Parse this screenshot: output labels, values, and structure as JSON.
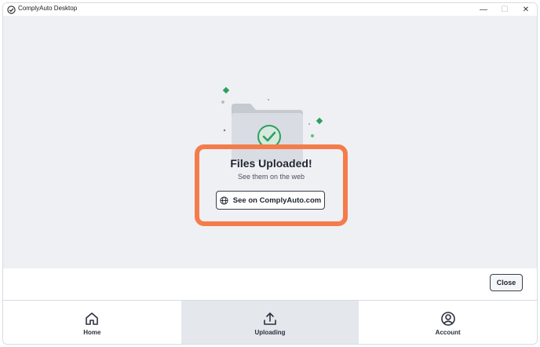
{
  "window": {
    "title": "ComplyAuto Desktop",
    "controls": {
      "minimize": "—",
      "maximize": "☐",
      "close": "✕"
    }
  },
  "status": {
    "title": "Files Uploaded!",
    "subtitle": "See them on the web",
    "web_button_label": "See on ComplyAuto.com",
    "web_button_icon": "globe-icon",
    "illustration_icon": "folder-check-icon",
    "highlight_color": "#f47c4b"
  },
  "footer": {
    "close_label": "Close"
  },
  "nav": {
    "items": [
      {
        "label": "Home",
        "icon": "home-icon",
        "active": false
      },
      {
        "label": "Uploading",
        "icon": "upload-icon",
        "active": true
      },
      {
        "label": "Account",
        "icon": "account-icon",
        "active": false
      }
    ]
  },
  "colors": {
    "accent_green": "#2f9e5f",
    "content_bg": "#eef0f3",
    "active_tab_bg": "#e4e7eb"
  }
}
